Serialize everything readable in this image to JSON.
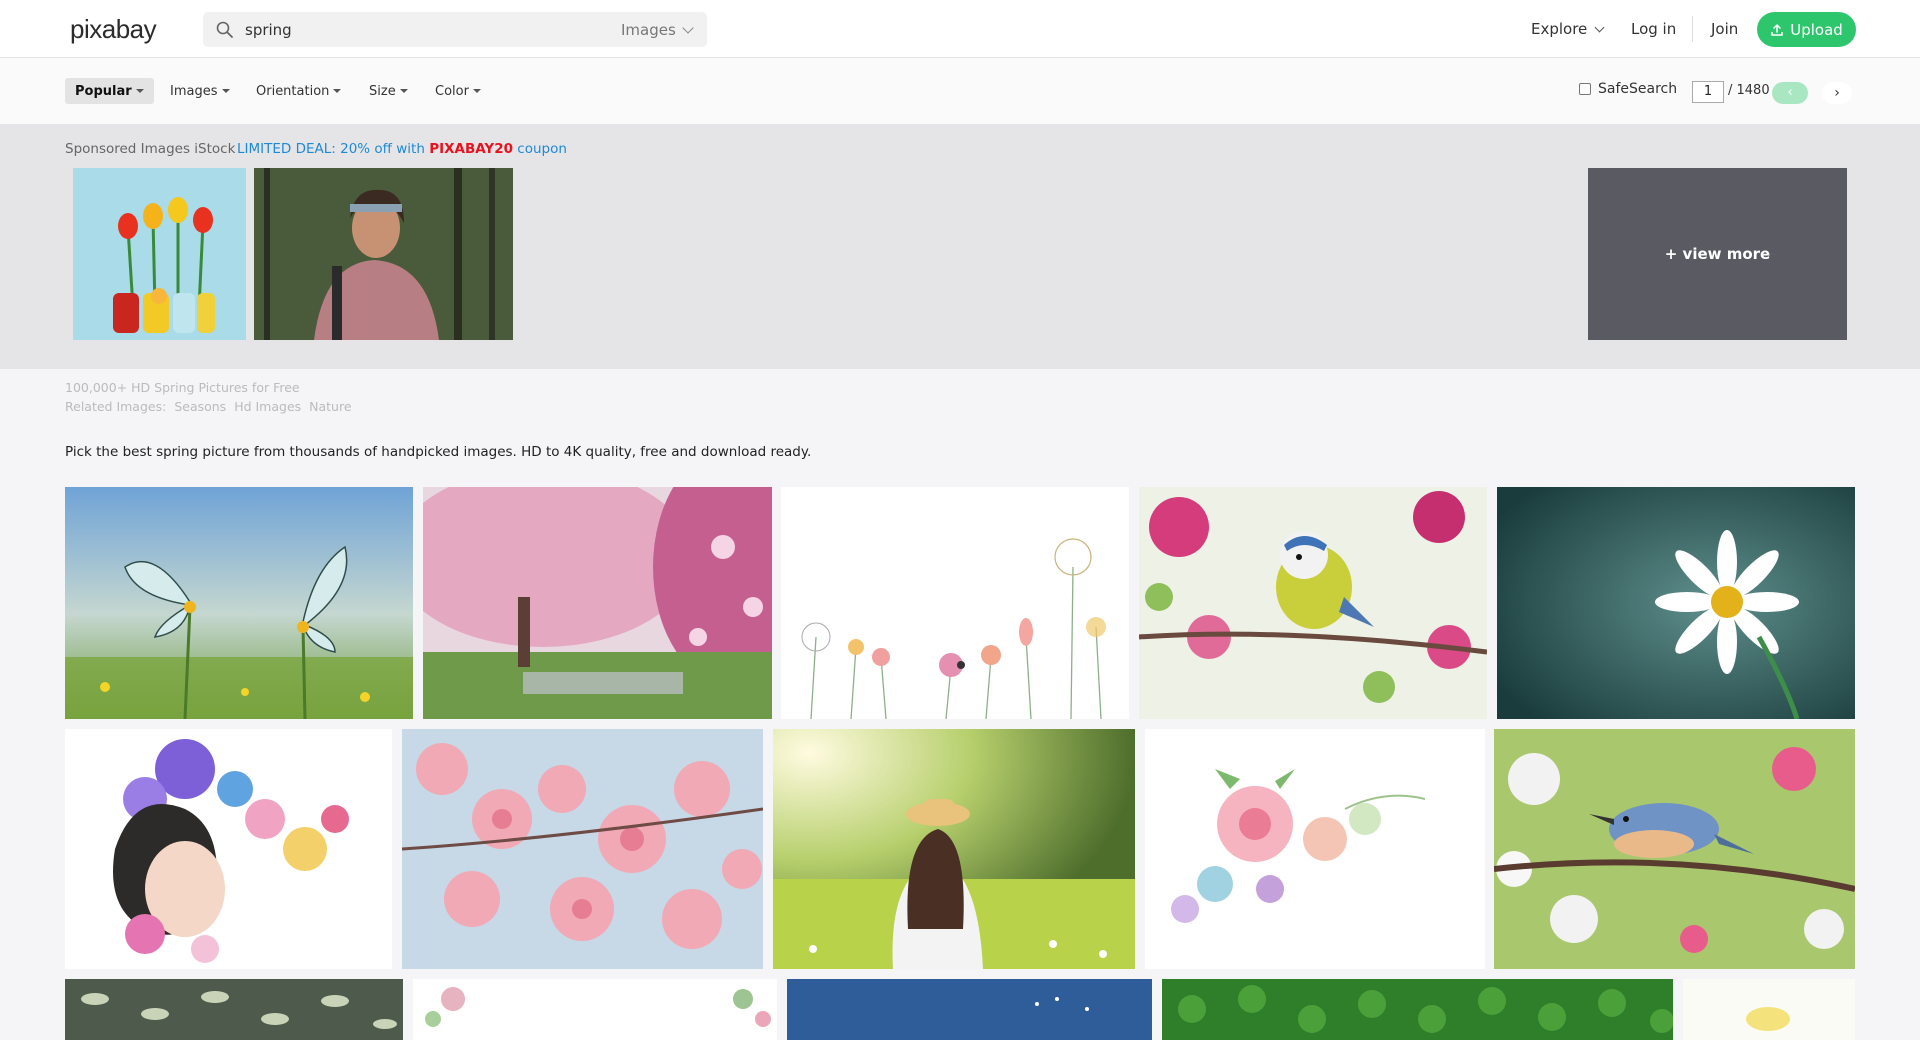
{
  "header": {
    "logo": "pixabay",
    "search_value": "spring",
    "search_type": "Images",
    "nav": {
      "explore": "Explore",
      "login": "Log in",
      "join": "Join",
      "upload": "Upload"
    },
    "accent_color": "#2ec66d"
  },
  "filters": {
    "items": [
      {
        "label": "Popular",
        "active": true
      },
      {
        "label": "Images"
      },
      {
        "label": "Orientation"
      },
      {
        "label": "Size"
      },
      {
        "label": "Color"
      }
    ],
    "safesearch_label": "SafeSearch",
    "safesearch_checked": false,
    "page_current": "1",
    "page_total": "/ 1480",
    "prev_icon": "‹",
    "next_icon": "›"
  },
  "sponsored": {
    "label": "Sponsored Images iStock",
    "deal_prefix": "LIMITED DEAL: 20% off with",
    "deal_code": "PIXABAY20",
    "deal_suffix": "coupon",
    "view_more": "+ view more"
  },
  "intro": {
    "heading": "100,000+ HD Spring Pictures for Free",
    "related_label": "Related Images:",
    "related": [
      "Seasons",
      "Hd Images",
      "Nature"
    ],
    "description": "Pick the best spring picture from thousands of handpicked images. HD to 4K quality, free and download ready."
  },
  "grid": {
    "row1": [
      "butterflies-meadow",
      "blossom-tree-park",
      "watercolor-wildflowers",
      "blue-tit-on-branch",
      "white-daisy"
    ],
    "row2": [
      "girl-flower-illustration",
      "pink-cherry-blossoms",
      "woman-in-meadow",
      "watercolor-flower-wreath",
      "nuthatch-in-blossoms"
    ],
    "row3": [
      "leaf-pattern",
      "floral-watercolor-corner",
      "blue-sky-dandelion",
      "green-leaves",
      "yellow-flower"
    ]
  }
}
